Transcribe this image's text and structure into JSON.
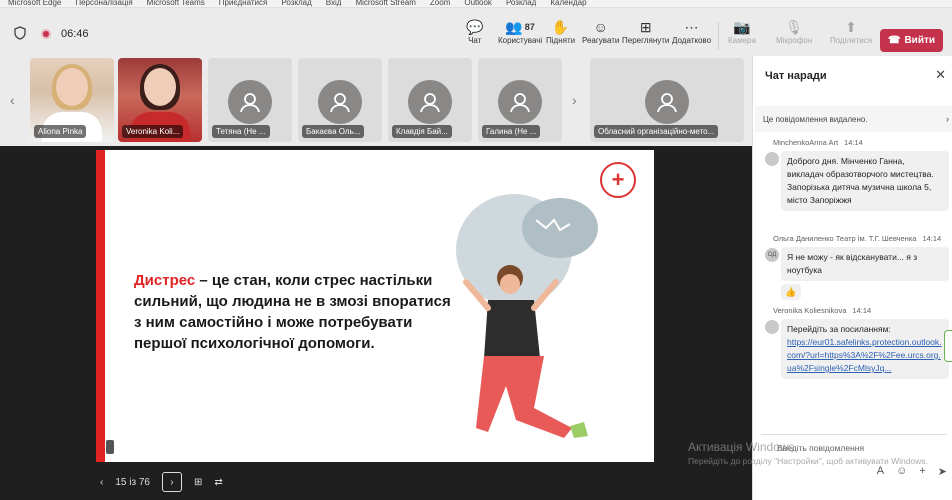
{
  "bookmarks": [
    "Microsoft Edge",
    "Персоналізація",
    "Microsoft Teams",
    "Приєднатися",
    "Розклад",
    "Вхід",
    "Microsoft Stream",
    "Zoom",
    "Outlook",
    "Розклад",
    "Календар"
  ],
  "toolbar": {
    "timer": "06:46",
    "items": [
      {
        "label": "Чат",
        "icon": "chat-icon",
        "glyph": "💬"
      },
      {
        "label": "Користувачі",
        "icon": "people-icon",
        "glyph": "👥",
        "count": "87"
      },
      {
        "label": "Підняти",
        "icon": "raise-hand-icon",
        "glyph": "✋"
      },
      {
        "label": "Реагувати",
        "icon": "react-icon",
        "glyph": "☺"
      },
      {
        "label": "Переглянути",
        "icon": "view-icon",
        "glyph": "⊞"
      },
      {
        "label": "Додатково",
        "icon": "more-icon",
        "glyph": "⋯"
      },
      {
        "label": "Камера",
        "icon": "camera-icon",
        "glyph": "📷"
      },
      {
        "label": "Мікрофон",
        "icon": "mic-icon",
        "glyph": "🎙"
      },
      {
        "label": "Поділитися",
        "icon": "share-icon",
        "glyph": "⬆"
      }
    ],
    "leave_label": "Вийти",
    "leave_color": "#c4314b"
  },
  "participants": [
    {
      "name": "Aliona Pinka"
    },
    {
      "name": "Veronika Koli..."
    },
    {
      "name": "Тетяна (Не ..."
    },
    {
      "name": "Бакаєва Оль..."
    },
    {
      "name": "Клавдія Бай..."
    },
    {
      "name": "Галина (Не ..."
    },
    {
      "name": "Обласний організаційно-мето..."
    }
  ],
  "slide": {
    "highlight": "Дистрес",
    "body": " – це стан, коли стрес настільки сильний, що людина не в змозі впоратися з ним самостійно і може потребувати першої психологічної допомоги.",
    "page_indicator": "15 із 76",
    "accent_color": "#e02424"
  },
  "chat": {
    "title": "Чат наради",
    "deleted_notice": "Це повідомлення видалено.",
    "messages": [
      {
        "author": "MinchenkoAnna Art",
        "time": "14:14",
        "initials": "",
        "text": "Доброго дня. Мінченко Ганна, викладач образотворчого мистецтва. Запорізька дитяча музична школа 5, місто Запоріжжя"
      },
      {
        "author": "Ольга Даниленко Театр ім. Т.Г. Шевченка",
        "time": "14:14",
        "initials": "ОД",
        "text": "Я не можу - як відсканувати... я з ноутбука",
        "reaction": "👍"
      },
      {
        "author": "Veronika Koliesnikova",
        "time": "14:14",
        "initials": "",
        "text": "Перейдіть за посиланням:",
        "link": "https://eur01.safelinks.protection.outlook.com/?url=https%3A%2F%2Fee.urcs.org.ua%2Fsingle%2FcMlsyJq..."
      }
    ],
    "composer_placeholder": "Введіть повідомлення"
  },
  "watermark": {
    "title": "Активація Windows",
    "line": "Перейдіть до розділу \"Настройки\", щоб активувати Windows."
  }
}
